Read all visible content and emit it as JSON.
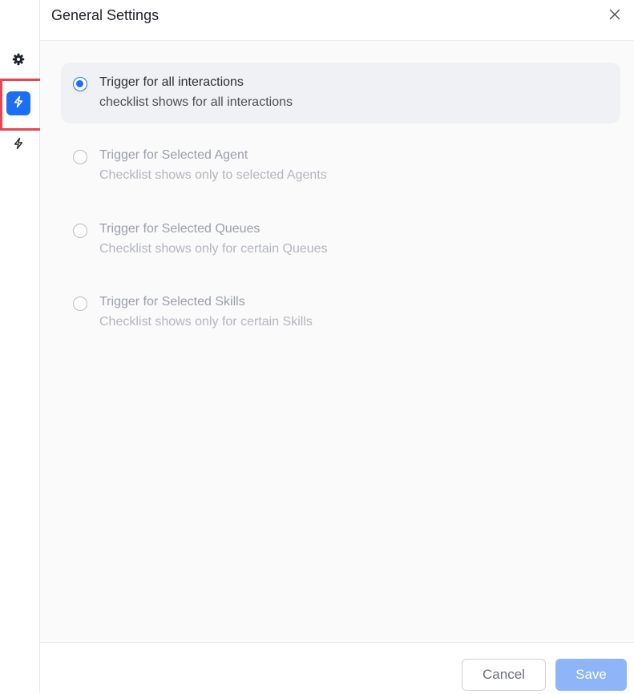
{
  "header": {
    "title": "General Settings",
    "close_icon": "close-icon"
  },
  "sidebar": {
    "items": [
      {
        "icon": "gear-icon",
        "active": false
      },
      {
        "icon": "lightning-icon",
        "active": true
      },
      {
        "icon": "lightning-outline-icon",
        "active": false
      }
    ]
  },
  "options": [
    {
      "title": "Trigger for all interactions",
      "subtitle": "checklist shows for all interactions",
      "selected": true,
      "disabled": false
    },
    {
      "title": "Trigger for Selected Agent",
      "subtitle": "Checklist shows only to selected Agents",
      "selected": false,
      "disabled": true
    },
    {
      "title": "Trigger for Selected Queues",
      "subtitle": "Checklist shows only for certain Queues",
      "selected": false,
      "disabled": true
    },
    {
      "title": "Trigger for Selected Skills",
      "subtitle": "Checklist shows only for certain Skills",
      "selected": false,
      "disabled": true
    }
  ],
  "footer": {
    "cancel_label": "Cancel",
    "save_label": "Save"
  },
  "colors": {
    "accent": "#1c6ef2",
    "highlight": "#e5464f",
    "save_disabled": "#8db5f7"
  }
}
